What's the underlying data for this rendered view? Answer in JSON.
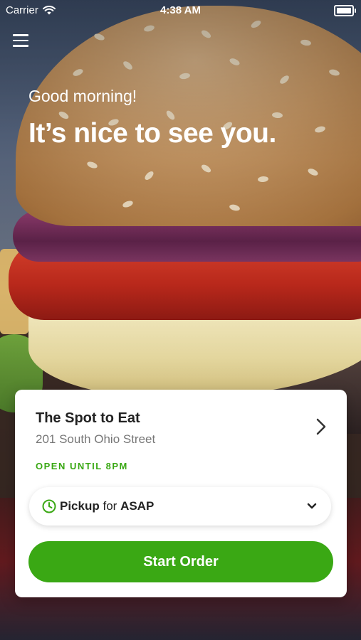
{
  "status_bar": {
    "carrier": "Carrier",
    "time": "4:38 AM"
  },
  "header": {
    "greeting": "Good morning!",
    "headline": "It’s nice to see you."
  },
  "store": {
    "name": "The Spot to Eat",
    "address": "201 South Ohio Street",
    "status": "OPEN UNTIL 8PM"
  },
  "order_mode": {
    "mode": "Pickup",
    "connector": "for",
    "time": "ASAP"
  },
  "actions": {
    "start_order": "Start Order"
  },
  "icons": {
    "menu": "hamburger-menu-icon",
    "wifi": "wifi-icon",
    "battery": "battery-icon",
    "store_chevron": "chevron-right-icon",
    "clock": "clock-icon",
    "dropdown": "chevron-down-icon"
  },
  "colors": {
    "accent": "#3aa814",
    "text": "#222222",
    "muted": "#777777"
  }
}
